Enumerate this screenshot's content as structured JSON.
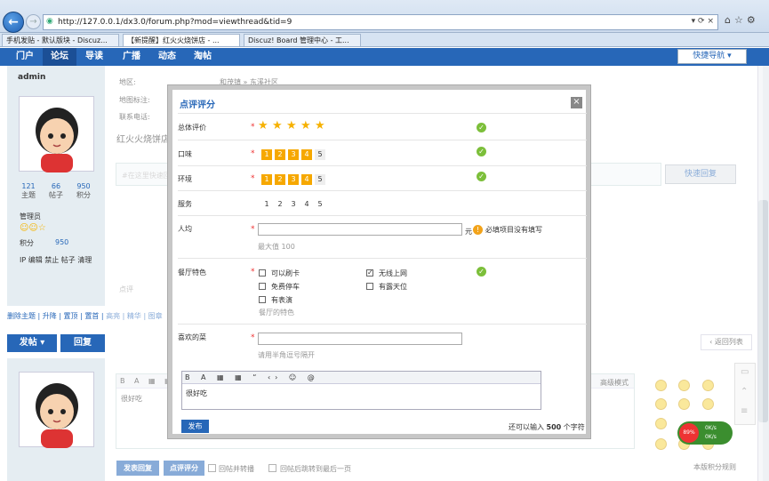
{
  "browser": {
    "url": "http://127.0.0.1/dx3.0/forum.php?mod=viewthread&tid=9",
    "addr_controls": "▾ ⟳ ×",
    "tabs": [
      {
        "label": "手机发贴 - 默认版块 - Discuz..."
      },
      {
        "label": "【新提醒】红火火烧饼店 - ..."
      },
      {
        "label": "Discuz! Board 管理中心 - 工..."
      }
    ]
  },
  "nav": {
    "items": [
      "门户",
      "论坛",
      "导读",
      "广播",
      "动态",
      "淘帖"
    ],
    "quick_nav": "快捷导航 ▾"
  },
  "post": {
    "author": "admin",
    "stats": [
      {
        "value": "121",
        "label": "主题"
      },
      {
        "value": "66",
        "label": "帖子"
      },
      {
        "value": "950",
        "label": "积分"
      }
    ],
    "role": "管理员",
    "score_label": "积分",
    "score_value": "950",
    "admin_links": "IP 编辑 禁止 帖子 清理",
    "rows": [
      {
        "label": "地区:",
        "value": "和茂镇 » 东溪社区"
      },
      {
        "label": "地图标注:",
        "value": ""
      },
      {
        "label": "联系电话:",
        "value": ""
      }
    ],
    "body": "红火火烧饼店，",
    "quick_input_placeholder": "#在这里快速回复",
    "quick_reply": "快速回复",
    "rate_label": "点评"
  },
  "modbar": "删除主题 | 升降 | 置顶 | 置首 | 高亮 | 精华 | 图章",
  "actions": {
    "post": "发帖 ▾",
    "reply": "回复",
    "back": "返回列表"
  },
  "reply_editor": {
    "content": "很好吃",
    "advanced": "高级模式",
    "send": "发表回复",
    "rate": "点评评分",
    "opt1": "回帖并转播",
    "opt2": "回帖后跳转到最后一页",
    "rules": "本版积分规则"
  },
  "dialog": {
    "title": "点评评分",
    "close": "×",
    "overall": {
      "label": "总体评价",
      "stars": 5
    },
    "taste": {
      "label": "口味",
      "options": [
        "1",
        "2",
        "3",
        "4",
        "5"
      ],
      "selected": 4
    },
    "env": {
      "label": "环境",
      "options": [
        "1",
        "2",
        "3",
        "4",
        "5"
      ],
      "selected": 4
    },
    "service": {
      "label": "服务",
      "options": [
        "1",
        "2",
        "3",
        "4",
        "5"
      ],
      "selected": 0
    },
    "avg": {
      "label": "人均",
      "unit": "元",
      "hint": "最大值 100",
      "error": "必填项目没有填写"
    },
    "features": {
      "label": "餐厅特色",
      "items": [
        {
          "label": "可以刷卡",
          "checked": false
        },
        {
          "label": "无线上网",
          "checked": true
        },
        {
          "label": "免费停车",
          "checked": false
        },
        {
          "label": "有露天位",
          "checked": false
        },
        {
          "label": "有表演",
          "checked": false
        }
      ],
      "hint": "餐厅的特色"
    },
    "dish": {
      "label": "喜欢的菜",
      "hint": "请用半角逗号隔开"
    },
    "editor_content": "很好吃",
    "publish": "发布",
    "remaining_prefix": "还可以输入",
    "remaining_count": "500",
    "remaining_suffix": "个字符"
  },
  "netwidget": {
    "pct": "89%",
    "up": "0K/s",
    "down": "0K/s"
  }
}
